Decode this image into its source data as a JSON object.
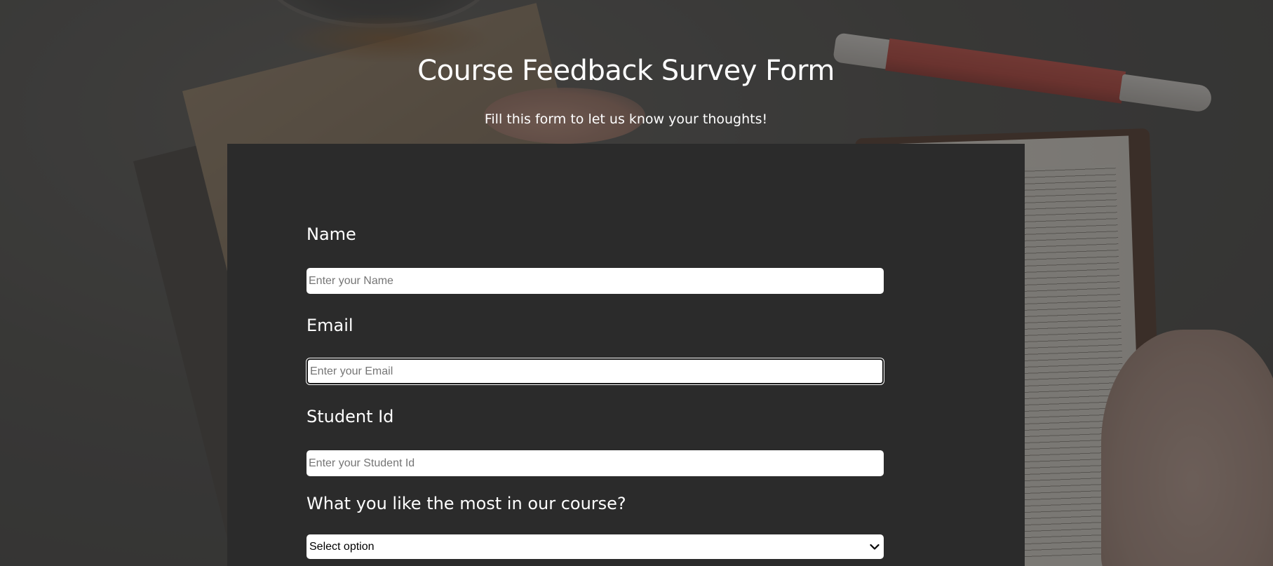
{
  "header": {
    "title": "Course Feedback Survey Form",
    "description": "Fill this form to let us know your thoughts!"
  },
  "form": {
    "name": {
      "label": "Name",
      "placeholder": "Enter your Name",
      "value": ""
    },
    "email": {
      "label": "Email",
      "placeholder": "Enter your Email",
      "value": "",
      "focused": true
    },
    "student_id": {
      "label": "Student Id",
      "placeholder": "Enter your Student Id",
      "value": ""
    },
    "liked_most": {
      "label": "What you like the most in our course?",
      "selected": "Select option",
      "icon": "chevron-down-icon"
    }
  },
  "colors": {
    "card_background": "#2b2b2b",
    "text": "#ffffff",
    "input_background": "#ffffff"
  }
}
